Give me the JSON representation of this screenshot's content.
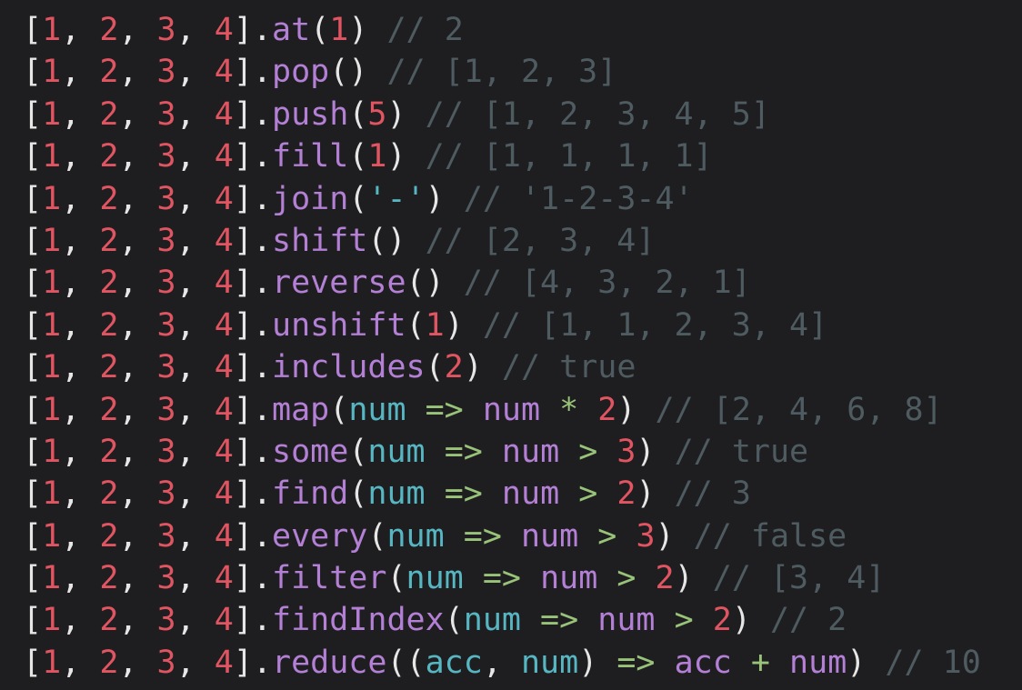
{
  "colors": {
    "background": "#1e1e20",
    "punctuation": "#e6e6e6",
    "number": "#e05561",
    "method": "#b480d6",
    "string_param": "#56b6c2",
    "arrow_operator": "#98c379",
    "comment": "#4e5b61"
  },
  "lines": [
    [
      [
        "p",
        "["
      ],
      [
        "n",
        "1"
      ],
      [
        "p",
        ", "
      ],
      [
        "n",
        "2"
      ],
      [
        "p",
        ", "
      ],
      [
        "n",
        "3"
      ],
      [
        "p",
        ", "
      ],
      [
        "n",
        "4"
      ],
      [
        "p",
        "]."
      ],
      [
        "f",
        "at"
      ],
      [
        "p",
        "("
      ],
      [
        "n",
        "1"
      ],
      [
        "p",
        ") "
      ],
      [
        "c",
        "// 2"
      ]
    ],
    [
      [
        "p",
        "["
      ],
      [
        "n",
        "1"
      ],
      [
        "p",
        ", "
      ],
      [
        "n",
        "2"
      ],
      [
        "p",
        ", "
      ],
      [
        "n",
        "3"
      ],
      [
        "p",
        ", "
      ],
      [
        "n",
        "4"
      ],
      [
        "p",
        "]."
      ],
      [
        "f",
        "pop"
      ],
      [
        "p",
        "() "
      ],
      [
        "c",
        "// [1, 2, 3]"
      ]
    ],
    [
      [
        "p",
        "["
      ],
      [
        "n",
        "1"
      ],
      [
        "p",
        ", "
      ],
      [
        "n",
        "2"
      ],
      [
        "p",
        ", "
      ],
      [
        "n",
        "3"
      ],
      [
        "p",
        ", "
      ],
      [
        "n",
        "4"
      ],
      [
        "p",
        "]."
      ],
      [
        "f",
        "push"
      ],
      [
        "p",
        "("
      ],
      [
        "n",
        "5"
      ],
      [
        "p",
        ") "
      ],
      [
        "c",
        "// [1, 2, 3, 4, 5]"
      ]
    ],
    [
      [
        "p",
        "["
      ],
      [
        "n",
        "1"
      ],
      [
        "p",
        ", "
      ],
      [
        "n",
        "2"
      ],
      [
        "p",
        ", "
      ],
      [
        "n",
        "3"
      ],
      [
        "p",
        ", "
      ],
      [
        "n",
        "4"
      ],
      [
        "p",
        "]."
      ],
      [
        "f",
        "fill"
      ],
      [
        "p",
        "("
      ],
      [
        "n",
        "1"
      ],
      [
        "p",
        ") "
      ],
      [
        "c",
        "// [1, 1, 1, 1]"
      ]
    ],
    [
      [
        "p",
        "["
      ],
      [
        "n",
        "1"
      ],
      [
        "p",
        ", "
      ],
      [
        "n",
        "2"
      ],
      [
        "p",
        ", "
      ],
      [
        "n",
        "3"
      ],
      [
        "p",
        ", "
      ],
      [
        "n",
        "4"
      ],
      [
        "p",
        "]."
      ],
      [
        "f",
        "join"
      ],
      [
        "p",
        "("
      ],
      [
        "s",
        "'-'"
      ],
      [
        "p",
        ") "
      ],
      [
        "c",
        "// '1-2-3-4'"
      ]
    ],
    [
      [
        "p",
        "["
      ],
      [
        "n",
        "1"
      ],
      [
        "p",
        ", "
      ],
      [
        "n",
        "2"
      ],
      [
        "p",
        ", "
      ],
      [
        "n",
        "3"
      ],
      [
        "p",
        ", "
      ],
      [
        "n",
        "4"
      ],
      [
        "p",
        "]."
      ],
      [
        "f",
        "shift"
      ],
      [
        "p",
        "() "
      ],
      [
        "c",
        "// [2, 3, 4]"
      ]
    ],
    [
      [
        "p",
        "["
      ],
      [
        "n",
        "1"
      ],
      [
        "p",
        ", "
      ],
      [
        "n",
        "2"
      ],
      [
        "p",
        ", "
      ],
      [
        "n",
        "3"
      ],
      [
        "p",
        ", "
      ],
      [
        "n",
        "4"
      ],
      [
        "p",
        "]."
      ],
      [
        "f",
        "reverse"
      ],
      [
        "p",
        "() "
      ],
      [
        "c",
        "// [4, 3, 2, 1]"
      ]
    ],
    [
      [
        "p",
        "["
      ],
      [
        "n",
        "1"
      ],
      [
        "p",
        ", "
      ],
      [
        "n",
        "2"
      ],
      [
        "p",
        ", "
      ],
      [
        "n",
        "3"
      ],
      [
        "p",
        ", "
      ],
      [
        "n",
        "4"
      ],
      [
        "p",
        "]."
      ],
      [
        "f",
        "unshift"
      ],
      [
        "p",
        "("
      ],
      [
        "n",
        "1"
      ],
      [
        "p",
        ") "
      ],
      [
        "c",
        "// [1, 1, 2, 3, 4]"
      ]
    ],
    [
      [
        "p",
        "["
      ],
      [
        "n",
        "1"
      ],
      [
        "p",
        ", "
      ],
      [
        "n",
        "2"
      ],
      [
        "p",
        ", "
      ],
      [
        "n",
        "3"
      ],
      [
        "p",
        ", "
      ],
      [
        "n",
        "4"
      ],
      [
        "p",
        "]."
      ],
      [
        "f",
        "includes"
      ],
      [
        "p",
        "("
      ],
      [
        "n",
        "2"
      ],
      [
        "p",
        ") "
      ],
      [
        "c",
        "// true"
      ]
    ],
    [
      [
        "p",
        "["
      ],
      [
        "n",
        "1"
      ],
      [
        "p",
        ", "
      ],
      [
        "n",
        "2"
      ],
      [
        "p",
        ", "
      ],
      [
        "n",
        "3"
      ],
      [
        "p",
        ", "
      ],
      [
        "n",
        "4"
      ],
      [
        "p",
        "]."
      ],
      [
        "f",
        "map"
      ],
      [
        "p",
        "("
      ],
      [
        "s",
        "num"
      ],
      [
        "p",
        " "
      ],
      [
        "a",
        "=>"
      ],
      [
        "p",
        " "
      ],
      [
        "f",
        "num"
      ],
      [
        "p",
        " "
      ],
      [
        "a",
        "*"
      ],
      [
        "p",
        " "
      ],
      [
        "n",
        "2"
      ],
      [
        "p",
        ") "
      ],
      [
        "c",
        "// [2, 4, 6, 8]"
      ]
    ],
    [
      [
        "p",
        "["
      ],
      [
        "n",
        "1"
      ],
      [
        "p",
        ", "
      ],
      [
        "n",
        "2"
      ],
      [
        "p",
        ", "
      ],
      [
        "n",
        "3"
      ],
      [
        "p",
        ", "
      ],
      [
        "n",
        "4"
      ],
      [
        "p",
        "]."
      ],
      [
        "f",
        "some"
      ],
      [
        "p",
        "("
      ],
      [
        "s",
        "num"
      ],
      [
        "p",
        " "
      ],
      [
        "a",
        "=>"
      ],
      [
        "p",
        " "
      ],
      [
        "f",
        "num"
      ],
      [
        "p",
        " "
      ],
      [
        "a",
        ">"
      ],
      [
        "p",
        " "
      ],
      [
        "n",
        "3"
      ],
      [
        "p",
        ") "
      ],
      [
        "c",
        "// true"
      ]
    ],
    [
      [
        "p",
        "["
      ],
      [
        "n",
        "1"
      ],
      [
        "p",
        ", "
      ],
      [
        "n",
        "2"
      ],
      [
        "p",
        ", "
      ],
      [
        "n",
        "3"
      ],
      [
        "p",
        ", "
      ],
      [
        "n",
        "4"
      ],
      [
        "p",
        "]."
      ],
      [
        "f",
        "find"
      ],
      [
        "p",
        "("
      ],
      [
        "s",
        "num"
      ],
      [
        "p",
        " "
      ],
      [
        "a",
        "=>"
      ],
      [
        "p",
        " "
      ],
      [
        "f",
        "num"
      ],
      [
        "p",
        " "
      ],
      [
        "a",
        ">"
      ],
      [
        "p",
        " "
      ],
      [
        "n",
        "2"
      ],
      [
        "p",
        ") "
      ],
      [
        "c",
        "// 3"
      ]
    ],
    [
      [
        "p",
        "["
      ],
      [
        "n",
        "1"
      ],
      [
        "p",
        ", "
      ],
      [
        "n",
        "2"
      ],
      [
        "p",
        ", "
      ],
      [
        "n",
        "3"
      ],
      [
        "p",
        ", "
      ],
      [
        "n",
        "4"
      ],
      [
        "p",
        "]."
      ],
      [
        "f",
        "every"
      ],
      [
        "p",
        "("
      ],
      [
        "s",
        "num"
      ],
      [
        "p",
        " "
      ],
      [
        "a",
        "=>"
      ],
      [
        "p",
        " "
      ],
      [
        "f",
        "num"
      ],
      [
        "p",
        " "
      ],
      [
        "a",
        ">"
      ],
      [
        "p",
        " "
      ],
      [
        "n",
        "3"
      ],
      [
        "p",
        ") "
      ],
      [
        "c",
        "// false"
      ]
    ],
    [
      [
        "p",
        "["
      ],
      [
        "n",
        "1"
      ],
      [
        "p",
        ", "
      ],
      [
        "n",
        "2"
      ],
      [
        "p",
        ", "
      ],
      [
        "n",
        "3"
      ],
      [
        "p",
        ", "
      ],
      [
        "n",
        "4"
      ],
      [
        "p",
        "]."
      ],
      [
        "f",
        "filter"
      ],
      [
        "p",
        "("
      ],
      [
        "s",
        "num"
      ],
      [
        "p",
        " "
      ],
      [
        "a",
        "=>"
      ],
      [
        "p",
        " "
      ],
      [
        "f",
        "num"
      ],
      [
        "p",
        " "
      ],
      [
        "a",
        ">"
      ],
      [
        "p",
        " "
      ],
      [
        "n",
        "2"
      ],
      [
        "p",
        ") "
      ],
      [
        "c",
        "// [3, 4]"
      ]
    ],
    [
      [
        "p",
        "["
      ],
      [
        "n",
        "1"
      ],
      [
        "p",
        ", "
      ],
      [
        "n",
        "2"
      ],
      [
        "p",
        ", "
      ],
      [
        "n",
        "3"
      ],
      [
        "p",
        ", "
      ],
      [
        "n",
        "4"
      ],
      [
        "p",
        "]."
      ],
      [
        "f",
        "findIndex"
      ],
      [
        "p",
        "("
      ],
      [
        "s",
        "num"
      ],
      [
        "p",
        " "
      ],
      [
        "a",
        "=>"
      ],
      [
        "p",
        " "
      ],
      [
        "f",
        "num"
      ],
      [
        "p",
        " "
      ],
      [
        "a",
        ">"
      ],
      [
        "p",
        " "
      ],
      [
        "n",
        "2"
      ],
      [
        "p",
        ") "
      ],
      [
        "c",
        "// 2"
      ]
    ],
    [
      [
        "p",
        "["
      ],
      [
        "n",
        "1"
      ],
      [
        "p",
        ", "
      ],
      [
        "n",
        "2"
      ],
      [
        "p",
        ", "
      ],
      [
        "n",
        "3"
      ],
      [
        "p",
        ", "
      ],
      [
        "n",
        "4"
      ],
      [
        "p",
        "]."
      ],
      [
        "f",
        "reduce"
      ],
      [
        "p",
        "(("
      ],
      [
        "s",
        "acc"
      ],
      [
        "p",
        ", "
      ],
      [
        "s",
        "num"
      ],
      [
        "p",
        ") "
      ],
      [
        "a",
        "=>"
      ],
      [
        "p",
        " "
      ],
      [
        "f",
        "acc"
      ],
      [
        "p",
        " "
      ],
      [
        "a",
        "+"
      ],
      [
        "p",
        " "
      ],
      [
        "f",
        "num"
      ],
      [
        "p",
        ") "
      ],
      [
        "c",
        "// 10"
      ]
    ]
  ]
}
